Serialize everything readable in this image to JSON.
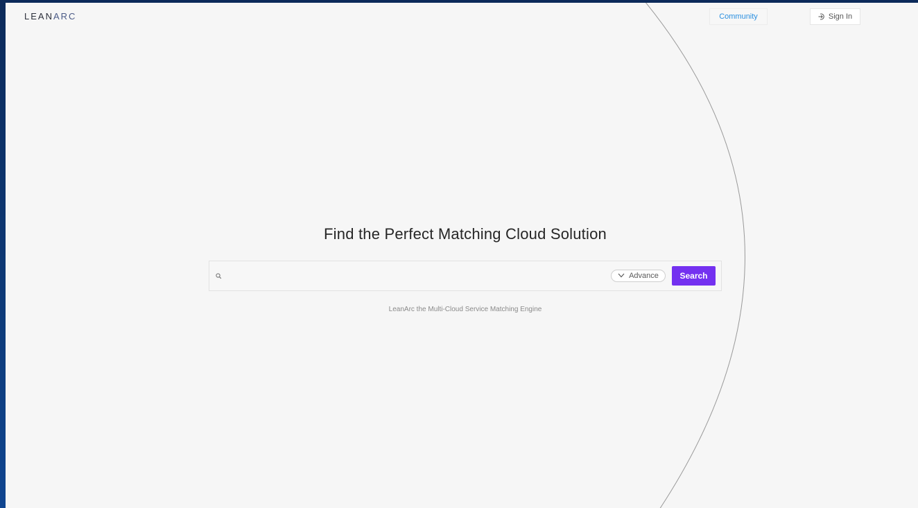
{
  "header": {
    "logo_lean": "LEAN",
    "logo_arc": "ARC",
    "community_label": "Community",
    "signin_label": "Sign In"
  },
  "hero": {
    "title": "Find the Perfect Matching Cloud Solution",
    "tagline": "LeanArc the Multi-Cloud Service Matching Engine"
  },
  "search": {
    "value": "",
    "placeholder": "",
    "advance_label": "Advance",
    "button_label": "Search"
  },
  "colors": {
    "accent": "#7431f0",
    "link": "#2a8fe0",
    "background": "#f6f6f6",
    "frame": "#0d3a78"
  },
  "icons": {
    "search": "search-icon",
    "signin": "sign-in-icon",
    "advance": "chevron-down-icon"
  }
}
